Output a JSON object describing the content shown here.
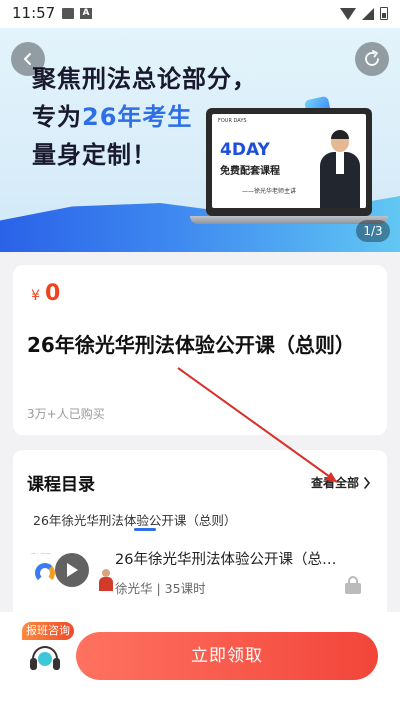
{
  "status_bar": {
    "time": "11:57"
  },
  "banner": {
    "headline_line1": "聚焦刑法总论部分，",
    "headline_line2_prefix": "专为",
    "headline_line2_highlight": "26年考生",
    "headline_line3": "量身定制！",
    "screen_small_text": "FOUR DAYS",
    "screen_big_text": "4DAY",
    "screen_sub_text": "免费配套课程",
    "screen_teacher_text": "——徐光华老师主讲",
    "pager": "1/3"
  },
  "price_card": {
    "currency": "¥",
    "price": "0",
    "title": "26年徐光华刑法体验公开课（总则）",
    "buyers": "3万+人已购买"
  },
  "catalog": {
    "heading": "课程目录",
    "view_all": "查看全部",
    "tab": "26年徐光华刑法体验公开课（总则）",
    "lesson": {
      "title": "26年徐光华刑法体验公开课（总…",
      "meta": "徐光华 | 35课时"
    }
  },
  "bottom_bar": {
    "consult_label": "报班咨询",
    "cta_label": "立即领取"
  },
  "colors": {
    "accent_red": "#f0421f",
    "accent_blue": "#2e6fe6",
    "cta_gradient_start": "#ff7260",
    "cta_gradient_end": "#f2453a"
  }
}
